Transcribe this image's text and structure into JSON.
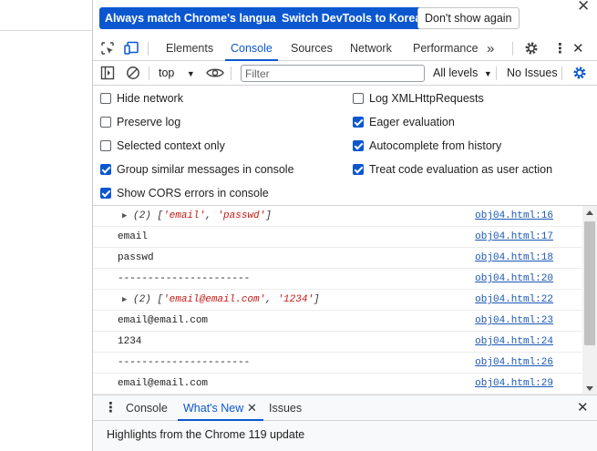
{
  "infobar": {
    "match_language_label": "Always match Chrome's language",
    "switch_korean_label": "Switch DevTools to Korean",
    "dont_show_label": "Don't show again",
    "close_icon": "close-icon"
  },
  "tabs": {
    "items": [
      "Elements",
      "Console",
      "Sources",
      "Network",
      "Performance"
    ],
    "active": "Console",
    "more_icon": "chevron-double-right-icon"
  },
  "toolbar": {
    "context": "top",
    "filter_placeholder": "Filter",
    "levels_label": "All levels",
    "issues_label": "No Issues"
  },
  "settings": {
    "left": [
      {
        "label": "Hide network",
        "checked": false
      },
      {
        "label": "Preserve log",
        "checked": false
      },
      {
        "label": "Selected context only",
        "checked": false
      },
      {
        "label": "Group similar messages in console",
        "checked": true
      },
      {
        "label": "Show CORS errors in console",
        "checked": true
      }
    ],
    "right": [
      {
        "label": "Log XMLHttpRequests",
        "checked": false
      },
      {
        "label": "Eager evaluation",
        "checked": true
      },
      {
        "label": "Autocomplete from history",
        "checked": true
      },
      {
        "label": "Treat code evaluation as user action",
        "checked": true
      }
    ]
  },
  "messages": [
    {
      "type": "array",
      "count": "(2)",
      "items": [
        "'email'",
        "'passwd'"
      ],
      "source": "obj04.html:16"
    },
    {
      "type": "text",
      "text": "email",
      "source": "obj04.html:17"
    },
    {
      "type": "text",
      "text": "passwd",
      "source": "obj04.html:18"
    },
    {
      "type": "text",
      "text": "----------------------",
      "source": "obj04.html:20"
    },
    {
      "type": "array",
      "count": "(2)",
      "items": [
        "'email@email.com'",
        "'1234'"
      ],
      "source": "obj04.html:22"
    },
    {
      "type": "text",
      "text": "email@email.com",
      "source": "obj04.html:23"
    },
    {
      "type": "text",
      "text": "1234",
      "source": "obj04.html:24"
    },
    {
      "type": "text",
      "text": "----------------------",
      "source": "obj04.html:26"
    },
    {
      "type": "text",
      "text": "email@email.com",
      "source": "obj04.html:29"
    }
  ],
  "drawer": {
    "tabs": [
      "Console",
      "What's New",
      "Issues"
    ],
    "active": "What's New",
    "body_text": "Highlights from the Chrome 119 update"
  },
  "colors": {
    "accent": "#0b57d0",
    "link": "#1a57b5",
    "string": "#c41a16"
  }
}
